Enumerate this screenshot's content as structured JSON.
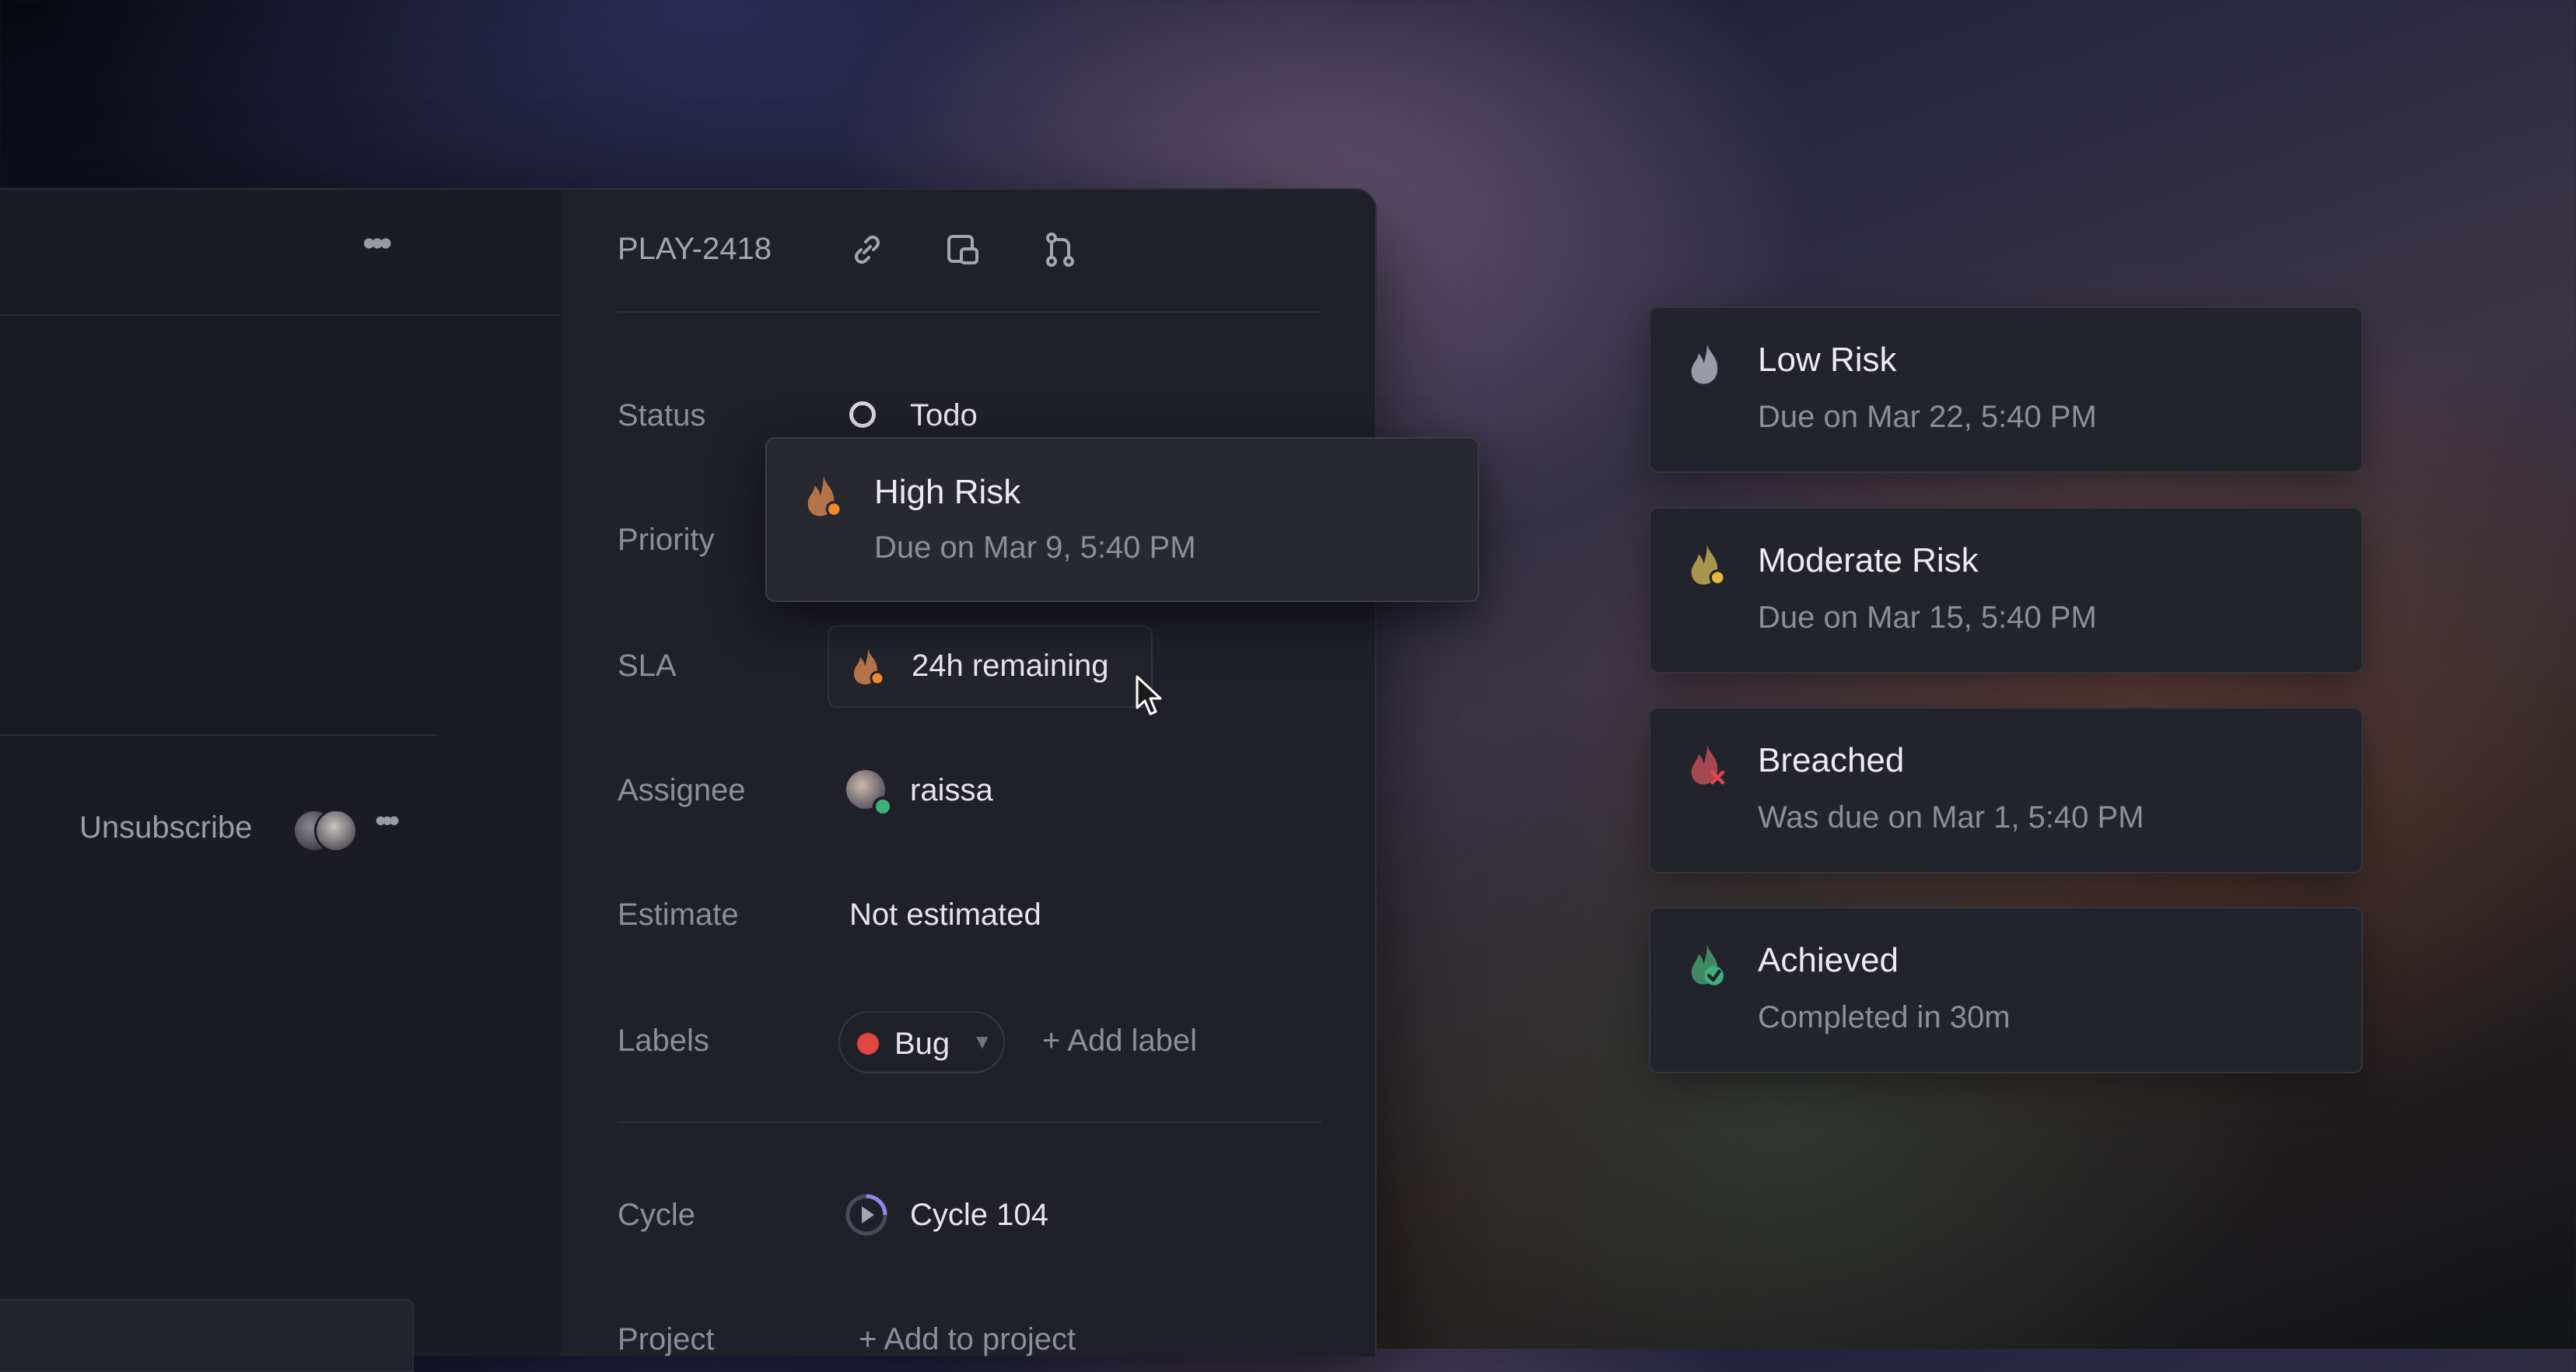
{
  "header": {
    "issue_id": "PLAY-2418"
  },
  "activity": {
    "unsubscribe_label": "Unsubscribe"
  },
  "properties": {
    "status": {
      "label": "Status",
      "value": "Todo"
    },
    "priority": {
      "label": "Priority"
    },
    "sla": {
      "label": "SLA",
      "value": "24h remaining"
    },
    "assignee": {
      "label": "Assignee",
      "value": "raissa"
    },
    "estimate": {
      "label": "Estimate",
      "value": "Not estimated"
    },
    "labels": {
      "label": "Labels",
      "tag": "Bug",
      "tag_color": "#e0473f",
      "add_label": "+ Add label"
    },
    "cycle": {
      "label": "Cycle",
      "value": "Cycle 104"
    },
    "project": {
      "label": "Project",
      "add": "+ Add to project"
    }
  },
  "sla_tooltip": {
    "title": "High Risk",
    "subtitle": "Due on Mar 9, 5:40 PM",
    "icon": "flame-orange-dot-icon"
  },
  "sla_states": [
    {
      "title": "Low Risk",
      "subtitle": "Due on Mar 22, 5:40 PM",
      "icon": "flame-gray-icon",
      "color": "#9a9ba5"
    },
    {
      "title": "Moderate Risk",
      "subtitle": "Due on Mar 15, 5:40 PM",
      "icon": "flame-yellow-dot-icon",
      "color": "#e8b83a"
    },
    {
      "title": "Breached",
      "subtitle": "Was due on Mar 1, 5:40 PM",
      "icon": "flame-red-x-icon",
      "color": "#e0474f"
    },
    {
      "title": "Achieved",
      "subtitle": "Completed in 30m",
      "icon": "flame-green-check-icon",
      "color": "#3cb179"
    }
  ]
}
